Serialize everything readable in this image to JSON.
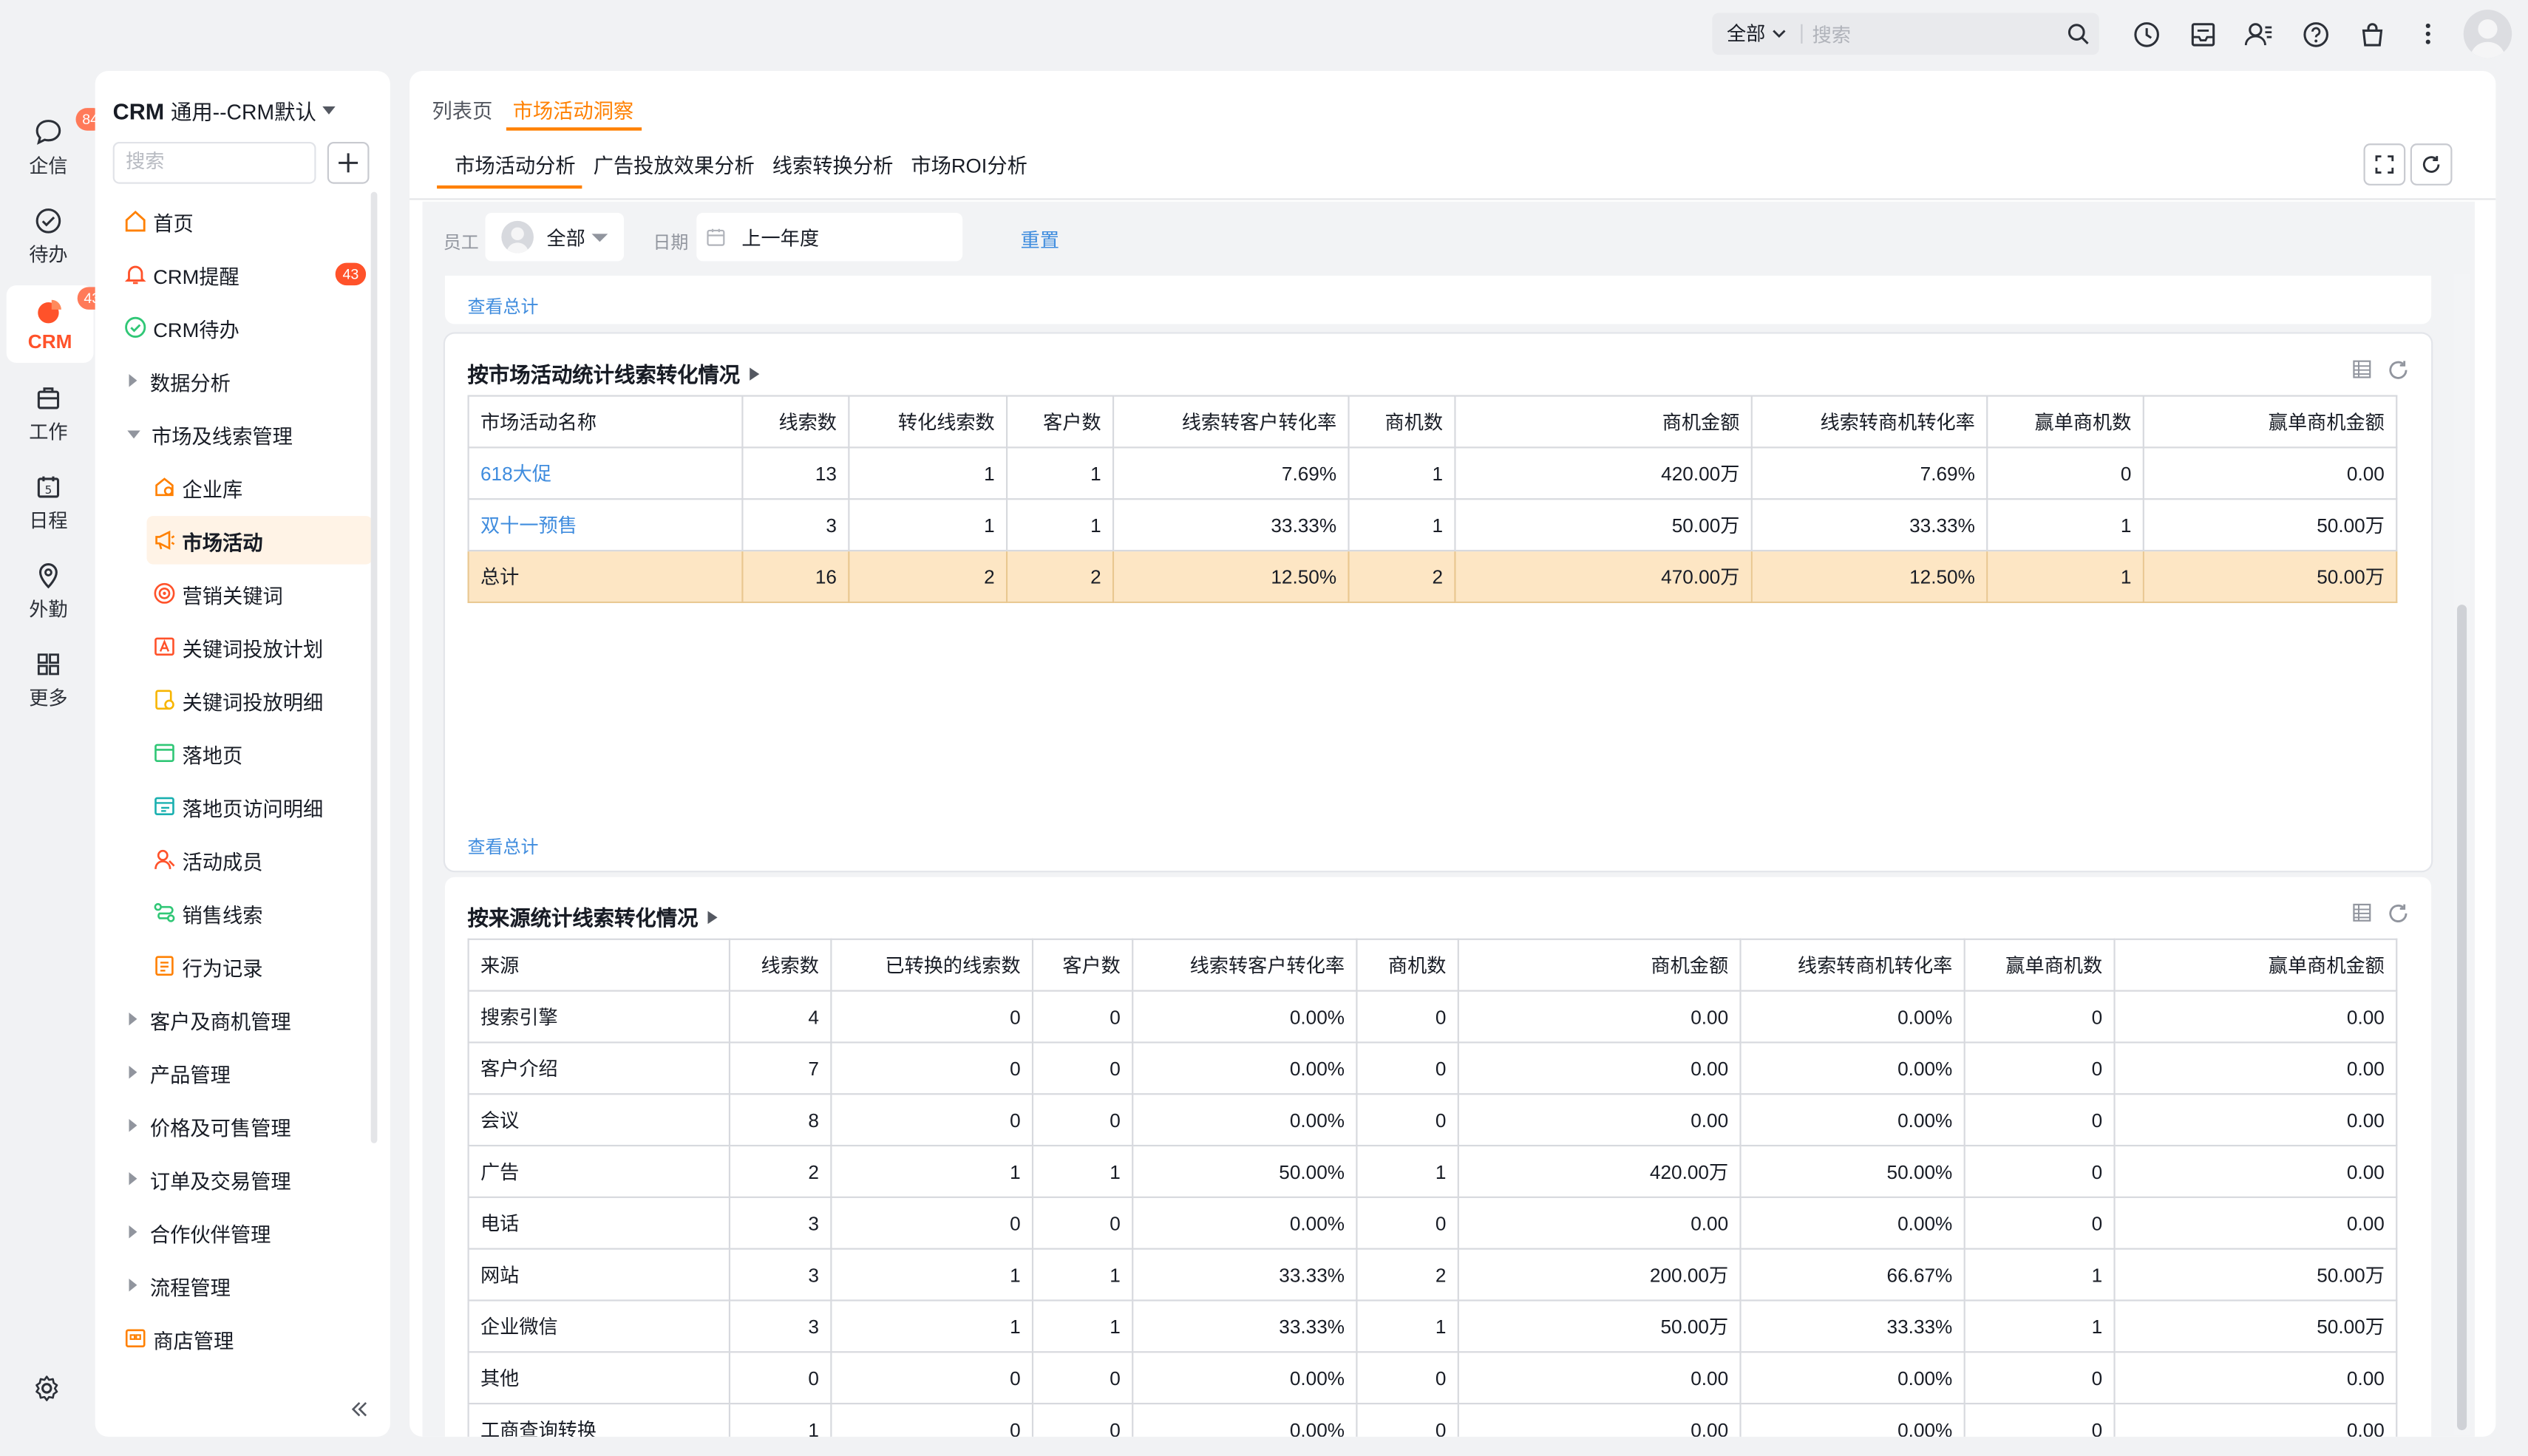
{
  "topbar": {
    "scope_label": "全部",
    "search_placeholder": "搜索",
    "icons": [
      "history-icon",
      "inbox-icon",
      "contacts-icon",
      "help-icon",
      "shop-icon",
      "more-icon",
      "user-avatar"
    ]
  },
  "rail": {
    "items": [
      {
        "label": "企信",
        "badge": "84",
        "icon": "chat-icon"
      },
      {
        "label": "待办",
        "badge": "",
        "icon": "todo-icon"
      },
      {
        "label": "CRM",
        "badge": "43",
        "icon": "crm-icon",
        "active": true
      },
      {
        "label": "工作",
        "badge": "",
        "icon": "work-icon"
      },
      {
        "label": "日程",
        "badge": "",
        "icon": "calendar-icon"
      },
      {
        "label": "外勤",
        "badge": "",
        "icon": "location-icon"
      },
      {
        "label": "更多",
        "badge": "",
        "icon": "grid-icon"
      }
    ],
    "settings_icon": "settings-icon"
  },
  "sidebar": {
    "app_name": "CRM",
    "app_scope": "通用--CRM默认",
    "search_placeholder": "搜索",
    "items": [
      {
        "label": "首页",
        "type": "link",
        "icon": "home-icon"
      },
      {
        "label": "CRM提醒",
        "type": "link",
        "icon": "bell-icon",
        "badge": "43"
      },
      {
        "label": "CRM待办",
        "type": "link",
        "icon": "check-circle-icon"
      },
      {
        "label": "数据分析",
        "type": "group"
      },
      {
        "label": "市场及线索管理",
        "type": "group-open"
      },
      {
        "label": "企业库",
        "type": "child",
        "icon": "company-icon"
      },
      {
        "label": "市场活动",
        "type": "child",
        "icon": "megaphone-icon",
        "active": true
      },
      {
        "label": "营销关键词",
        "type": "child",
        "icon": "target-icon"
      },
      {
        "label": "关键词投放计划",
        "type": "child",
        "icon": "keyword-plan-icon"
      },
      {
        "label": "关键词投放明细",
        "type": "child",
        "icon": "keyword-detail-icon"
      },
      {
        "label": "落地页",
        "type": "child",
        "icon": "landing-page-icon"
      },
      {
        "label": "落地页访问明细",
        "type": "child",
        "icon": "visit-detail-icon"
      },
      {
        "label": "活动成员",
        "type": "child",
        "icon": "member-icon"
      },
      {
        "label": "销售线索",
        "type": "child",
        "icon": "leads-icon"
      },
      {
        "label": "行为记录",
        "type": "child",
        "icon": "record-icon"
      },
      {
        "label": "客户及商机管理",
        "type": "group"
      },
      {
        "label": "产品管理",
        "type": "group"
      },
      {
        "label": "价格及可售管理",
        "type": "group"
      },
      {
        "label": "订单及交易管理",
        "type": "group"
      },
      {
        "label": "合作伙伴管理",
        "type": "group"
      },
      {
        "label": "流程管理",
        "type": "group"
      },
      {
        "label": "商店管理",
        "type": "link",
        "icon": "store-icon"
      }
    ]
  },
  "main": {
    "tabs": [
      {
        "label": "列表页"
      },
      {
        "label": "市场活动洞察",
        "active": true
      }
    ],
    "subtabs": [
      {
        "label": "市场活动分析",
        "active": true
      },
      {
        "label": "广告投放效果分析"
      },
      {
        "label": "线索转换分析"
      },
      {
        "label": "市场ROI分析"
      }
    ],
    "filters": {
      "employee_label": "员工",
      "employee_value": "全部",
      "date_label": "日期",
      "date_value": "上一年度",
      "reset_label": "重置"
    },
    "view_total": "查看总计",
    "activity_table": {
      "title": "按市场活动统计线索转化情况",
      "columns": [
        "市场活动名称",
        "线索数",
        "转化线索数",
        "客户数",
        "线索转客户转化率",
        "商机数",
        "商机金额",
        "线索转商机转化率",
        "赢单商机数",
        "赢单商机金额"
      ],
      "rows": [
        [
          "618大促",
          "13",
          "1",
          "1",
          "7.69%",
          "1",
          "420.00万",
          "7.69%",
          "0",
          "0.00"
        ],
        [
          "双十一预售",
          "3",
          "1",
          "1",
          "33.33%",
          "1",
          "50.00万",
          "33.33%",
          "1",
          "50.00万"
        ]
      ],
      "total": [
        "总计",
        "16",
        "2",
        "2",
        "12.50%",
        "2",
        "470.00万",
        "12.50%",
        "1",
        "50.00万"
      ]
    },
    "source_table": {
      "title": "按来源统计线索转化情况",
      "columns": [
        "来源",
        "线索数",
        "已转换的线索数",
        "客户数",
        "线索转客户转化率",
        "商机数",
        "商机金额",
        "线索转商机转化率",
        "赢单商机数",
        "赢单商机金额"
      ],
      "rows": [
        [
          "搜索引擎",
          "4",
          "0",
          "0",
          "0.00%",
          "0",
          "0.00",
          "0.00%",
          "0",
          "0.00"
        ],
        [
          "客户介绍",
          "7",
          "0",
          "0",
          "0.00%",
          "0",
          "0.00",
          "0.00%",
          "0",
          "0.00"
        ],
        [
          "会议",
          "8",
          "0",
          "0",
          "0.00%",
          "0",
          "0.00",
          "0.00%",
          "0",
          "0.00"
        ],
        [
          "广告",
          "2",
          "1",
          "1",
          "50.00%",
          "1",
          "420.00万",
          "50.00%",
          "0",
          "0.00"
        ],
        [
          "电话",
          "3",
          "0",
          "0",
          "0.00%",
          "0",
          "0.00",
          "0.00%",
          "0",
          "0.00"
        ],
        [
          "网站",
          "3",
          "1",
          "1",
          "33.33%",
          "2",
          "200.00万",
          "66.67%",
          "1",
          "50.00万"
        ],
        [
          "企业微信",
          "3",
          "1",
          "1",
          "33.33%",
          "1",
          "50.00万",
          "33.33%",
          "1",
          "50.00万"
        ],
        [
          "其他",
          "0",
          "0",
          "0",
          "0.00%",
          "0",
          "0.00",
          "0.00%",
          "0",
          "0.00"
        ],
        [
          "工商查询转换",
          "1",
          "0",
          "0",
          "0.00%",
          "0",
          "0.00",
          "0.00%",
          "0",
          "0.00"
        ]
      ]
    }
  },
  "colors": {
    "accent": "#ff8000",
    "crm_red": "#ff522a",
    "link": "#3f8cde",
    "total_row": "#fde6c4"
  }
}
